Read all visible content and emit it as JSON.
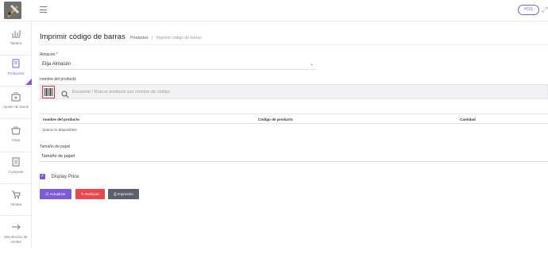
{
  "header": {
    "pos_label": "POS"
  },
  "sidebar": {
    "items": [
      {
        "label": "Tablero",
        "icon": "dashboard-chart-icon"
      },
      {
        "label": "Productos",
        "icon": "products-box-icon",
        "active": true
      },
      {
        "label": "Ajuste de Stock",
        "icon": "stock-adjust-icon"
      },
      {
        "label": "Citas",
        "icon": "quotations-icon"
      },
      {
        "label": "Compras",
        "icon": "purchases-icon"
      },
      {
        "label": "Ventas",
        "icon": "cart-icon"
      },
      {
        "label": "Devolución de ventas",
        "icon": "arrow-right-icon"
      }
    ]
  },
  "page": {
    "title": "Imprimir código de barras",
    "breadcrumb_parent": "Productos",
    "breadcrumb_sep": "|",
    "breadcrumb_current": "Imprimir código de barras"
  },
  "form": {
    "warehouse_label": "Almacén *",
    "warehouse_value": "Elija Almacén",
    "product_label": "nombre del producto",
    "search_placeholder": "Escanear / Buscar producto por nombre de código",
    "table_headers": [
      "nombre del producto",
      "Código de producto",
      "Cantidad"
    ],
    "empty_text": "Datos no disponibles",
    "paper_label": "Tamaño de papel",
    "paper_value": "Tamaño de papel",
    "display_price_label": "Display Price",
    "display_price_checked": true
  },
  "buttons": {
    "update": "Actualizar",
    "reset": "Reiniciar",
    "print": "Impresión"
  },
  "colors": {
    "accent": "#7b5bd6",
    "reset": "#e8484b",
    "print": "#5a5f6b"
  }
}
